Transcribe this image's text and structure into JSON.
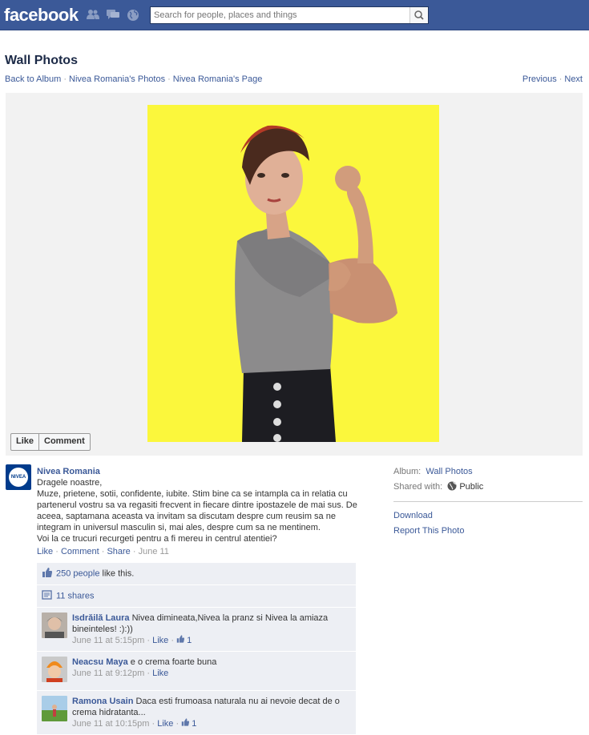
{
  "topbar": {
    "logo": "facebook",
    "search_placeholder": "Search for people, places and things"
  },
  "header": {
    "title": "Wall Photos",
    "breadcrumbs": [
      "Back to Album",
      "Nivea Romania's Photos",
      "Nivea Romania's Page"
    ],
    "previous": "Previous",
    "next": "Next"
  },
  "photo": {
    "like_label": "Like",
    "comment_label": "Comment",
    "background_color": "#fbf73c"
  },
  "post": {
    "avatar_text": "NIVEA",
    "author": "Nivea Romania",
    "lines": [
      "Dragele noastre,",
      "Muze, prietene, sotii, confidente, iubite. Stim bine ca se intampla ca in relatia cu partenerul vostru sa va regasiti frecvent in fiecare dintre ipostazele de mai sus. De aceea, saptamana aceasta va invitam sa discutam despre cum reusim sa ne integram in universul masculin si, mai ales, despre cum sa ne mentinem.",
      "Voi la ce trucuri recurgeti pentru a fi mereu in centrul atentiei?"
    ],
    "actions": {
      "like": "Like",
      "comment": "Comment",
      "share": "Share",
      "date": "June 11"
    }
  },
  "sidebar": {
    "album_label": "Album:",
    "album_value": "Wall Photos",
    "shared_label": "Shared with:",
    "shared_value": "Public",
    "download": "Download",
    "report": "Report This Photo"
  },
  "ufi": {
    "likes_link": "250 people",
    "likes_suffix": " like this.",
    "shares": "11 shares",
    "comments": [
      {
        "name": "Isdrăilă Laura",
        "text": "Nivea dimineata,Nivea la pranz si Nivea la amiaza bineinteles! :):))",
        "time": "June 11 at 5:15pm",
        "like": "Like",
        "likes": "1"
      },
      {
        "name": "Neacsu Maya",
        "text": "e o crema foarte buna",
        "time": "June 11 at 9:12pm",
        "like": "Like",
        "likes": ""
      },
      {
        "name": "Ramona Usain",
        "text": "Daca esti frumoasa naturala nu ai nevoie decat de o crema hidratanta...",
        "time": "June 11 at 10:15pm",
        "like": "Like",
        "likes": "1"
      }
    ]
  }
}
